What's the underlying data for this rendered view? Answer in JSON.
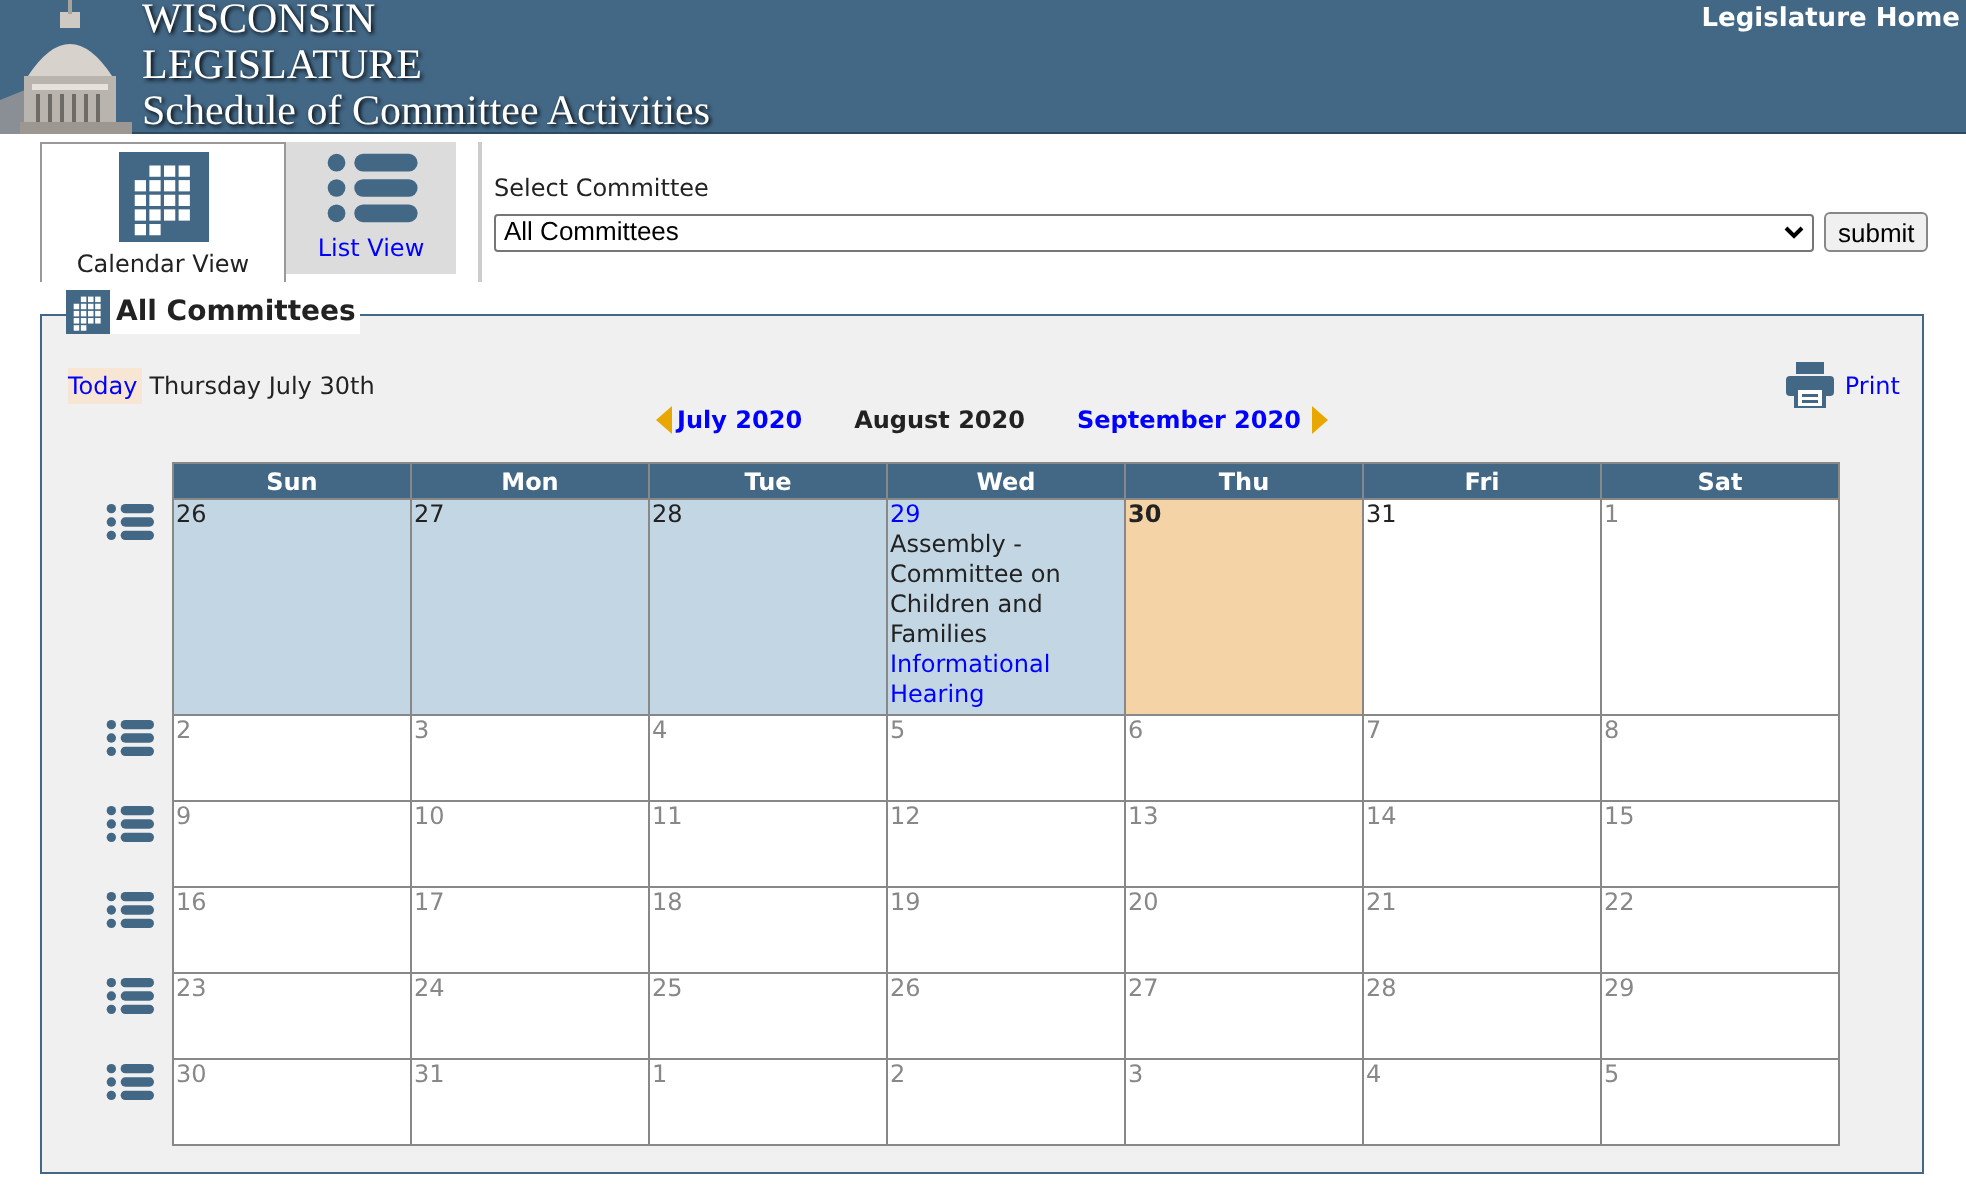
{
  "header": {
    "title_lines": [
      "WISCONSIN",
      "LEGISLATURE",
      "Schedule of Committee Activities"
    ],
    "home_link": "Legislature Home"
  },
  "view_tabs": [
    {
      "label": "Calendar View",
      "kind": "calendar",
      "selected": true
    },
    {
      "label": "List View",
      "kind": "list",
      "selected": false
    }
  ],
  "committee_select": {
    "label": "Select Committee",
    "value": "All Committees",
    "button": "submit"
  },
  "panel": {
    "title": "All Committees",
    "today_link": "Today",
    "today_text": "Thursday July 30th",
    "print": "Print",
    "prev_month": "July 2020",
    "current_month": "August 2020",
    "next_month": "September 2020"
  },
  "calendar": {
    "columns": [
      "Sun",
      "Mon",
      "Tue",
      "Wed",
      "Thu",
      "Fri",
      "Sat"
    ],
    "weeks": [
      [
        {
          "day": "26",
          "kind": "past"
        },
        {
          "day": "27",
          "kind": "past"
        },
        {
          "day": "28",
          "kind": "past"
        },
        {
          "day": "29",
          "kind": "past",
          "link": true,
          "events": [
            {
              "title": "Assembly - Committee on Children and Families",
              "link": "Informational Hearing"
            }
          ]
        },
        {
          "day": "30",
          "kind": "today"
        },
        {
          "day": "31",
          "kind": "current"
        },
        {
          "day": "1",
          "kind": "other"
        }
      ],
      [
        {
          "day": "2",
          "kind": "other"
        },
        {
          "day": "3",
          "kind": "other"
        },
        {
          "day": "4",
          "kind": "other"
        },
        {
          "day": "5",
          "kind": "other"
        },
        {
          "day": "6",
          "kind": "other"
        },
        {
          "day": "7",
          "kind": "other"
        },
        {
          "day": "8",
          "kind": "other"
        }
      ],
      [
        {
          "day": "9",
          "kind": "other"
        },
        {
          "day": "10",
          "kind": "other"
        },
        {
          "day": "11",
          "kind": "other"
        },
        {
          "day": "12",
          "kind": "other"
        },
        {
          "day": "13",
          "kind": "other"
        },
        {
          "day": "14",
          "kind": "other"
        },
        {
          "day": "15",
          "kind": "other"
        }
      ],
      [
        {
          "day": "16",
          "kind": "other"
        },
        {
          "day": "17",
          "kind": "other"
        },
        {
          "day": "18",
          "kind": "other"
        },
        {
          "day": "19",
          "kind": "other"
        },
        {
          "day": "20",
          "kind": "other"
        },
        {
          "day": "21",
          "kind": "other"
        },
        {
          "day": "22",
          "kind": "other"
        }
      ],
      [
        {
          "day": "23",
          "kind": "other"
        },
        {
          "day": "24",
          "kind": "other"
        },
        {
          "day": "25",
          "kind": "other"
        },
        {
          "day": "26",
          "kind": "other"
        },
        {
          "day": "27",
          "kind": "other"
        },
        {
          "day": "28",
          "kind": "other"
        },
        {
          "day": "29",
          "kind": "other"
        }
      ],
      [
        {
          "day": "30",
          "kind": "other"
        },
        {
          "day": "31",
          "kind": "other"
        },
        {
          "day": "1",
          "kind": "other"
        },
        {
          "day": "2",
          "kind": "other"
        },
        {
          "day": "3",
          "kind": "other"
        },
        {
          "day": "4",
          "kind": "other"
        },
        {
          "day": "5",
          "kind": "other"
        }
      ]
    ]
  }
}
